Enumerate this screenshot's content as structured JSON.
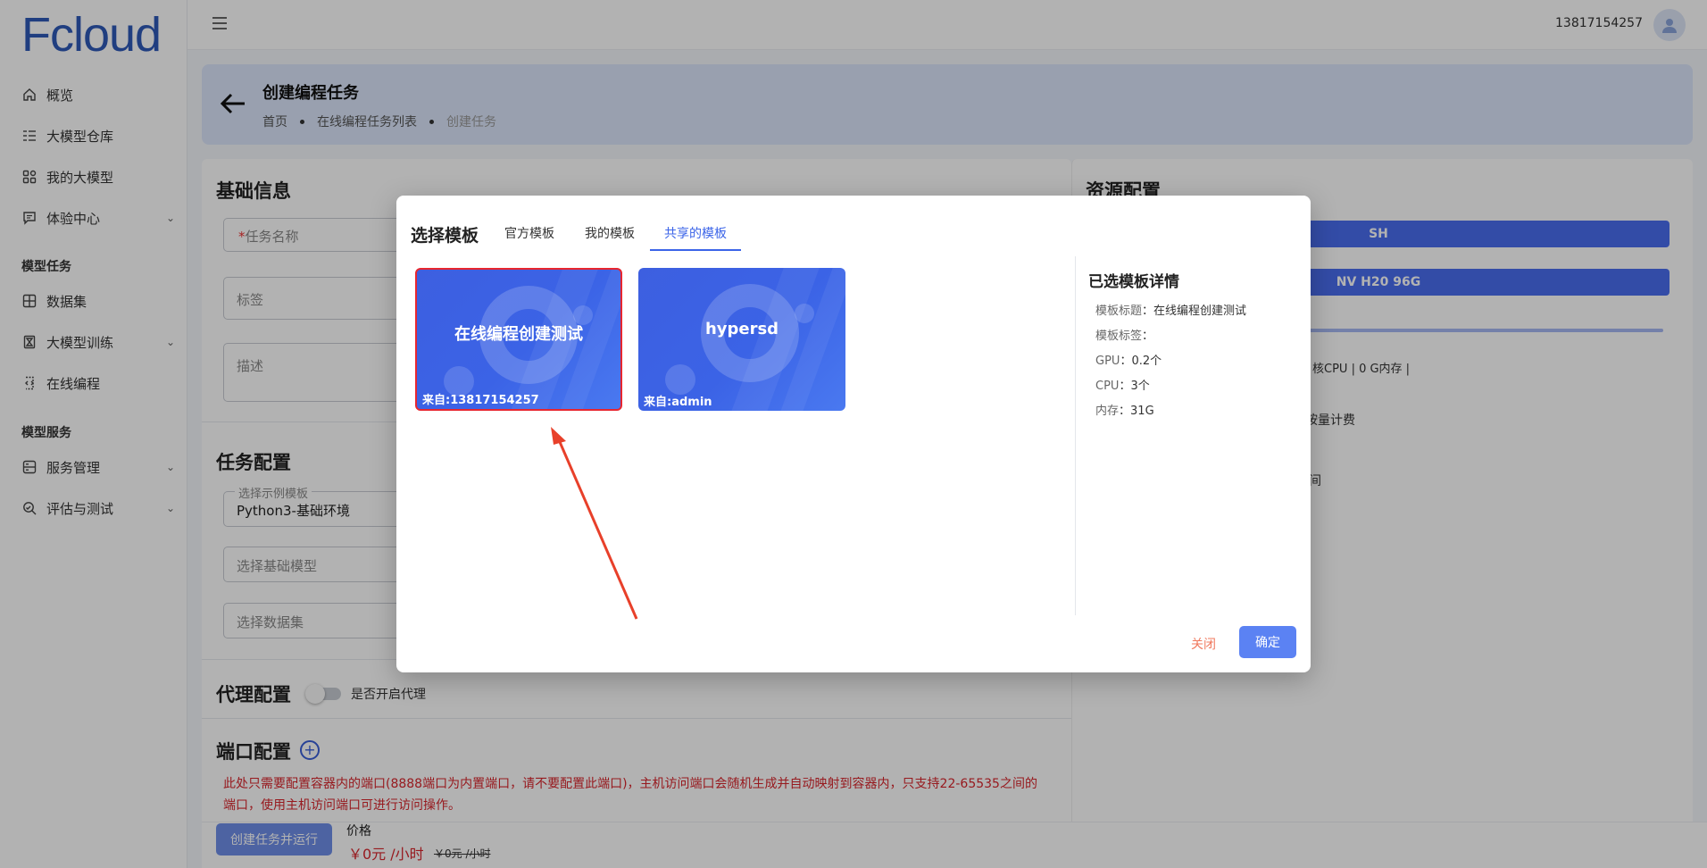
{
  "app": {
    "logo": "Fcloud"
  },
  "sidebar": {
    "items": [
      {
        "label": "概览",
        "icon": "home-icon"
      },
      {
        "label": "大模型仓库",
        "icon": "list-icon"
      },
      {
        "label": "我的大模型",
        "icon": "grid-icon"
      },
      {
        "label": "体验中心",
        "icon": "chat-icon"
      }
    ],
    "section_tasks": "模型任务",
    "task_items": [
      {
        "label": "数据集",
        "icon": "table-icon"
      },
      {
        "label": "大模型训练",
        "icon": "hourglass-icon"
      },
      {
        "label": "在线编程",
        "icon": "code-icon"
      }
    ],
    "section_services": "模型服务",
    "service_items": [
      {
        "label": "服务管理",
        "icon": "server-icon"
      },
      {
        "label": "评估与测试",
        "icon": "search-icon"
      }
    ]
  },
  "topbar": {
    "user": "13817154257"
  },
  "header": {
    "title": "创建编程任务",
    "breadcrumb": [
      "首页",
      "在线编程任务列表",
      "创建任务"
    ]
  },
  "form": {
    "basic_title": "基础信息",
    "name_placeholder": "任务名称",
    "name_required": "*",
    "tag_placeholder": "标签",
    "desc_placeholder": "描述",
    "task_title": "任务配置",
    "template_legend": "选择示例模板",
    "template_value": "Python3-基础环境",
    "base_model_placeholder": "选择基础模型",
    "dataset_placeholder": "选择数据集",
    "proxy_title": "代理配置",
    "proxy_label": "是否开启代理",
    "port_title": "端口配置",
    "port_warning": "此处只需要配置容器内的端口(8888端口为内置端口，请不要配置此端口)，主机访问端口会随机生成并自动映射到容器内，只支持22-65535之间的端口，使用主机访问端口可进行访问操作。"
  },
  "resources": {
    "title": "资源配置",
    "region": "SH",
    "gpu": "NV H20 96G",
    "spec_fragment": "核CPU | 0 G内存 |",
    "billing_fragment": "按量计费",
    "time_fragment": "间"
  },
  "footer": {
    "run_button": "创建任务并运行",
    "price_label": "价格",
    "price_now": "￥0元 /小时",
    "price_old": "￥0元 /小时"
  },
  "modal": {
    "title": "选择模板",
    "tabs": [
      "官方模板",
      "我的模板",
      "共享的模板"
    ],
    "active_tab": 2,
    "templates": [
      {
        "title": "在线编程创建测试",
        "from": "来自:13817154257",
        "selected": true
      },
      {
        "title": "hypersd",
        "from": "来自:admin",
        "selected": false
      }
    ],
    "detail": {
      "title": "已选模板详情",
      "rows": [
        {
          "k": "模板标题",
          "v": "在线编程创建测试"
        },
        {
          "k": "模板标签",
          "v": ""
        },
        {
          "k": "GPU",
          "v": "0.2个"
        },
        {
          "k": "CPU",
          "v": "3个"
        },
        {
          "k": "内存",
          "v": "31G"
        }
      ]
    },
    "close": "关闭",
    "confirm": "确定"
  },
  "colors": {
    "accent": "#3b64e8",
    "danger": "#d9262d",
    "annotation": "#e8402a"
  }
}
